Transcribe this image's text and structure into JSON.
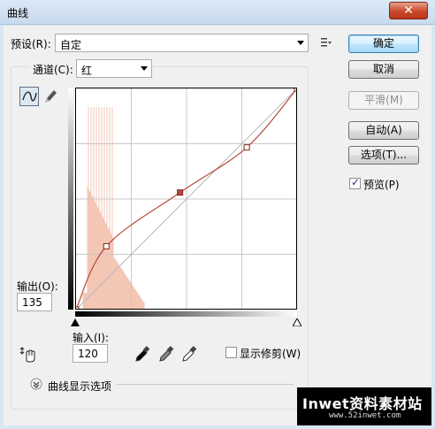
{
  "window": {
    "title": "曲线",
    "close_glyph": "✕"
  },
  "preset": {
    "label": "预设(R):",
    "value": "自定"
  },
  "channel": {
    "label": "通道(C):",
    "value": "红"
  },
  "buttons": {
    "ok": "确定",
    "cancel": "取消",
    "smooth": "平滑(M)",
    "auto": "自动(A)",
    "options": "选项(T)..."
  },
  "preview": {
    "label": "预览(P)",
    "checked": true,
    "check_glyph": "✓"
  },
  "output": {
    "label": "输出(O):",
    "value": "135"
  },
  "input": {
    "label": "输入(I):",
    "value": "120"
  },
  "show_clipping": {
    "label": "显示修剪(W)",
    "checked": false
  },
  "curve_display": {
    "label": "曲线显示选项",
    "expander_glyph": "»"
  },
  "icons": [
    "curve-point-tool-icon",
    "pencil-icon",
    "preset-menu-icon",
    "hand-adjust-icon",
    "black-eyedropper-icon",
    "gray-eyedropper-icon",
    "white-eyedropper-icon",
    "black-point-slider-icon",
    "white-point-slider-icon"
  ],
  "curve": {
    "channel_color": "#b84a3a",
    "histogram_color": "#f4c6b4",
    "points": [
      [
        0,
        0
      ],
      [
        35,
        73
      ],
      [
        120,
        135
      ],
      [
        197,
        187
      ],
      [
        255,
        255
      ]
    ]
  },
  "watermark": {
    "main": "Inwet资料素材站",
    "sub": "www.52inwet.com"
  }
}
